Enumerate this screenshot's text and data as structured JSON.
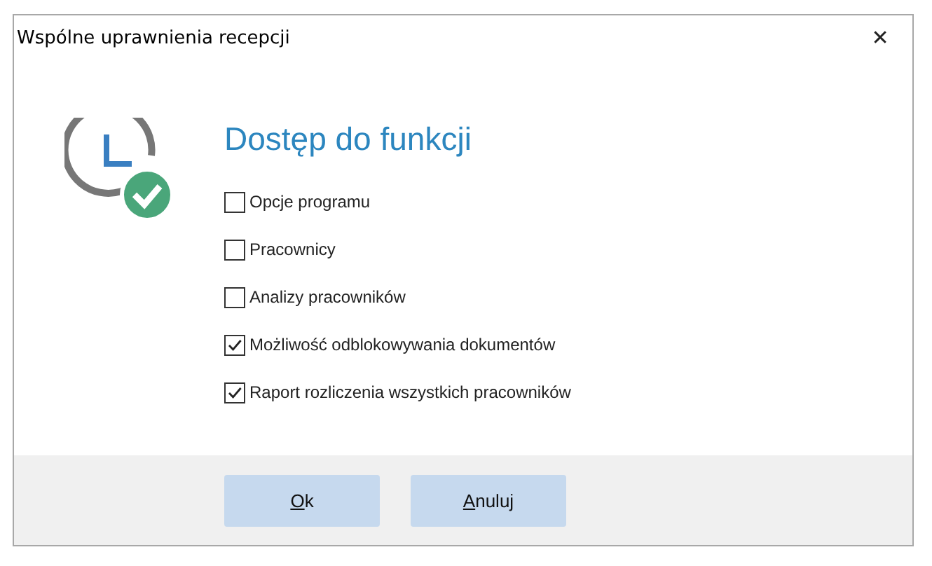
{
  "window": {
    "title": "Wspólne uprawnienia recepcji",
    "close": "✕"
  },
  "heading": "Dostęp do funkcji",
  "options": [
    {
      "label": "Opcje programu",
      "checked": false
    },
    {
      "label": "Pracownicy",
      "checked": false
    },
    {
      "label": "Analizy pracowników",
      "checked": false
    },
    {
      "label": "Możliwość odblokowywania dokumentów",
      "checked": true
    },
    {
      "label": "Raport rozliczenia wszystkich pracowników",
      "checked": true
    }
  ],
  "buttons": [
    {
      "mnemonic": "O",
      "rest": "k"
    },
    {
      "mnemonic": "A",
      "rest": "nuluj"
    }
  ]
}
